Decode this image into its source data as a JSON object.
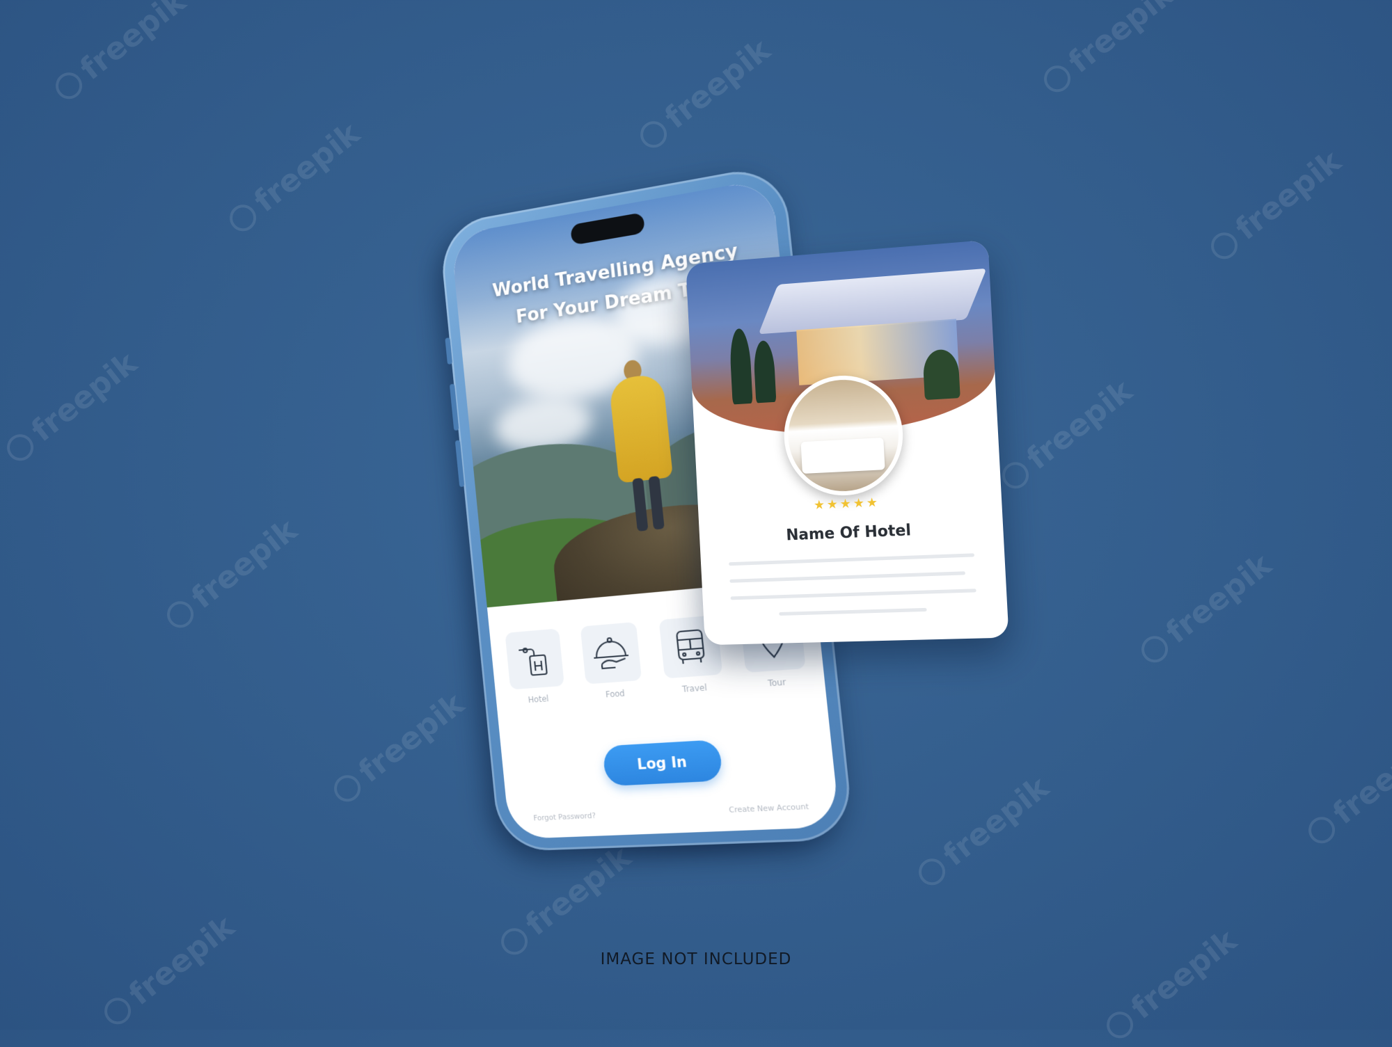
{
  "watermark": {
    "text": "freepik"
  },
  "app": {
    "hero_title_line1": "World Travelling Agency",
    "hero_title_line2": "For Your Dream Trip",
    "services": [
      {
        "icon": "hotel-key-icon",
        "label": "Hotel"
      },
      {
        "icon": "food-cloche-icon",
        "label": "Food"
      },
      {
        "icon": "bus-icon",
        "label": "Travel"
      },
      {
        "icon": "location-pin-icon",
        "label": "Tour"
      }
    ],
    "login_label": "Log In",
    "footer_left": "Forgot Password?",
    "footer_right": "Create New Account"
  },
  "hotel_card": {
    "stars": "★★★★★",
    "rating": 5,
    "name": "Name Of Hotel"
  },
  "caption": "IMAGE NOT INCLUDED",
  "colors": {
    "background": "#335d8c",
    "accent": "#2d86e0",
    "phone_frame": "#5a8fc4",
    "star": "#f1c232"
  }
}
